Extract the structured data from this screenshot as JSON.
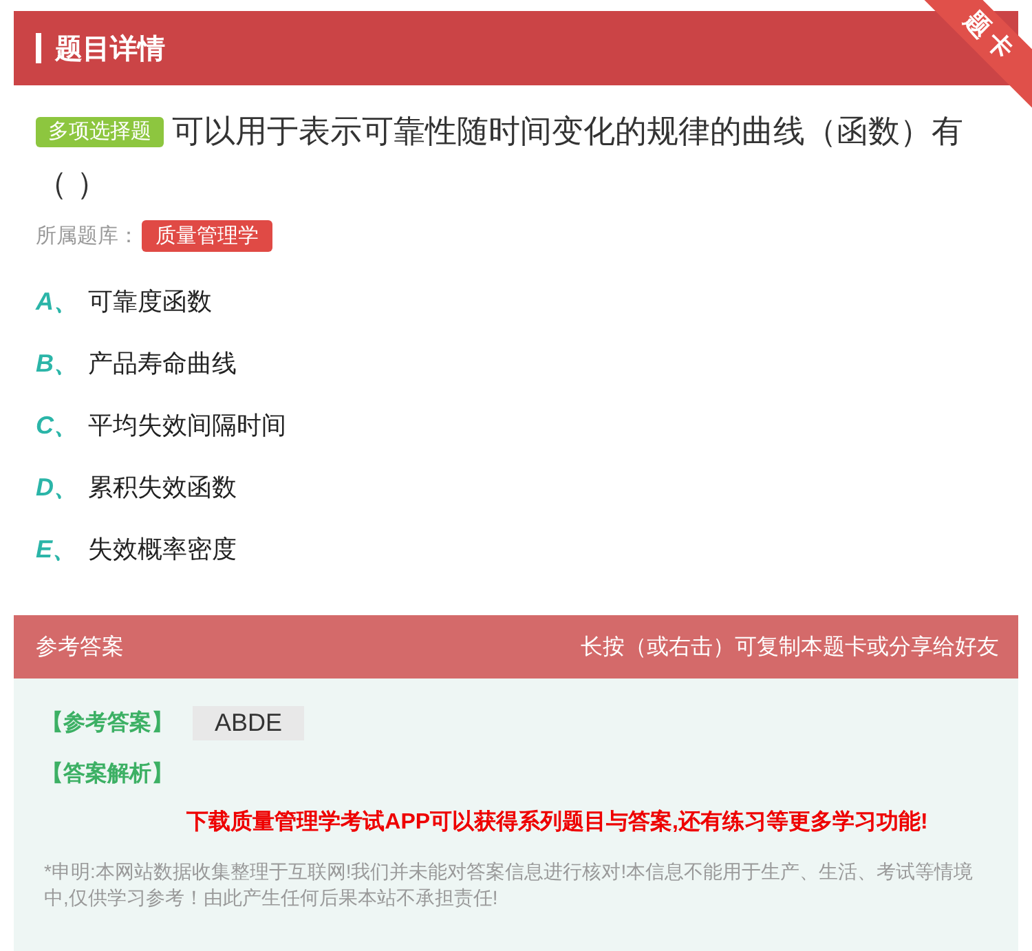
{
  "header": {
    "title": "题目详情",
    "ribbon": "题卡"
  },
  "question": {
    "type_tag": "多项选择题",
    "text": "可以用于表示可靠性随时间变化的规律的曲线（函数）有（ ）",
    "bank_label": "所属题库：",
    "bank": "质量管理学"
  },
  "options": [
    {
      "letter": "A、",
      "text": "可靠度函数"
    },
    {
      "letter": "B、",
      "text": "产品寿命曲线"
    },
    {
      "letter": "C、",
      "text": "平均失效间隔时间"
    },
    {
      "letter": "D、",
      "text": "累积失效函数"
    },
    {
      "letter": "E、",
      "text": "失效概率密度"
    }
  ],
  "answer": {
    "title": "参考答案",
    "hint": "长按（或右击）可复制本题卡或分享给好友",
    "answer_label": "【参考答案】",
    "answer_value": "ABDE",
    "analysis_label": "【答案解析】",
    "promo": "下载质量管理学考试APP可以获得系列题目与答案,还有练习等更多学习功能!",
    "disclaimer": "*申明:本网站数据收集整理于互联网!我们并未能对答案信息进行核对!本信息不能用于生产、生活、考试等情境中,仅供学习参考！由此产生任何后果本站不承担责任!"
  }
}
